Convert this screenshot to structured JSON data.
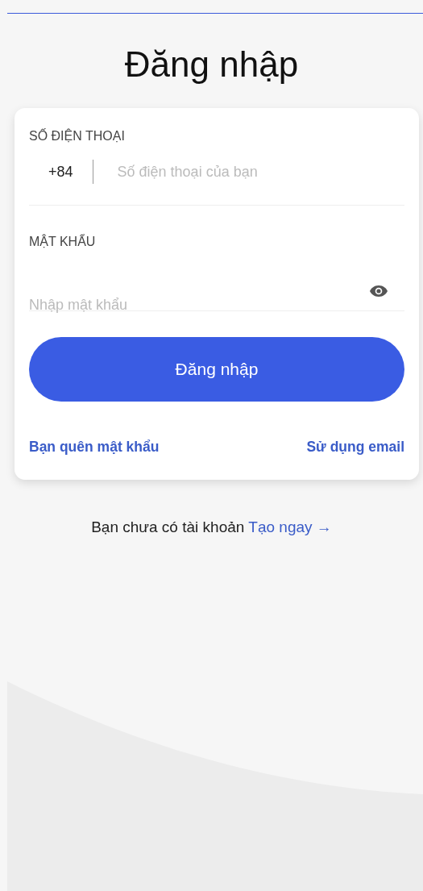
{
  "title": "Đăng nhập",
  "phone": {
    "label": "SỐ ĐIỆN THOẠI",
    "country_code": "+84",
    "placeholder": "Số điện thoại của bạn"
  },
  "password": {
    "label": "MẬT KHẨU",
    "placeholder": "Nhập mật khẩu"
  },
  "submit_button": "Đăng nhập",
  "links": [
    {
      "text": "Bạn quên mật khẩu"
    },
    {
      "text": "Sử dụng email"
    }
  ],
  "footer": {
    "text": "Bạn chưa có tài khoản",
    "link": "Tạo ngay →"
  }
}
